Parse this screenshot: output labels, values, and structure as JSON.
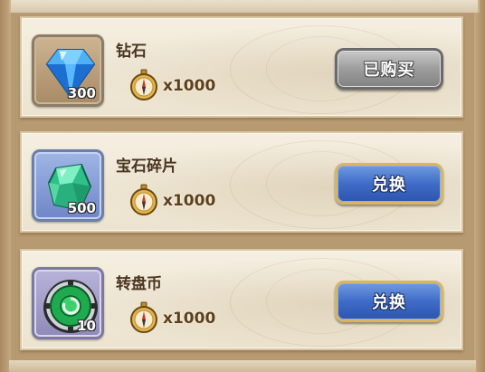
{
  "items": [
    {
      "name": "钻石",
      "quantity": "300",
      "icon": "diamond-icon",
      "cost_icon": "compass-icon",
      "price": "x1000",
      "button_label": "已购买",
      "button_state": "purchased"
    },
    {
      "name": "宝石碎片",
      "quantity": "500",
      "icon": "gem-shard-icon",
      "cost_icon": "compass-icon",
      "price": "x1000",
      "button_label": "兑换",
      "button_state": "available"
    },
    {
      "name": "转盘币",
      "quantity": "10",
      "icon": "spin-coin-icon",
      "cost_icon": "compass-icon",
      "price": "x1000",
      "button_label": "兑换",
      "button_state": "available"
    }
  ],
  "colors": {
    "button_available": "#3f6cc8",
    "button_purchased": "#9d9d9d",
    "button_border_gold": "#d9b55e",
    "panel_bg": "#f1e9d8"
  }
}
